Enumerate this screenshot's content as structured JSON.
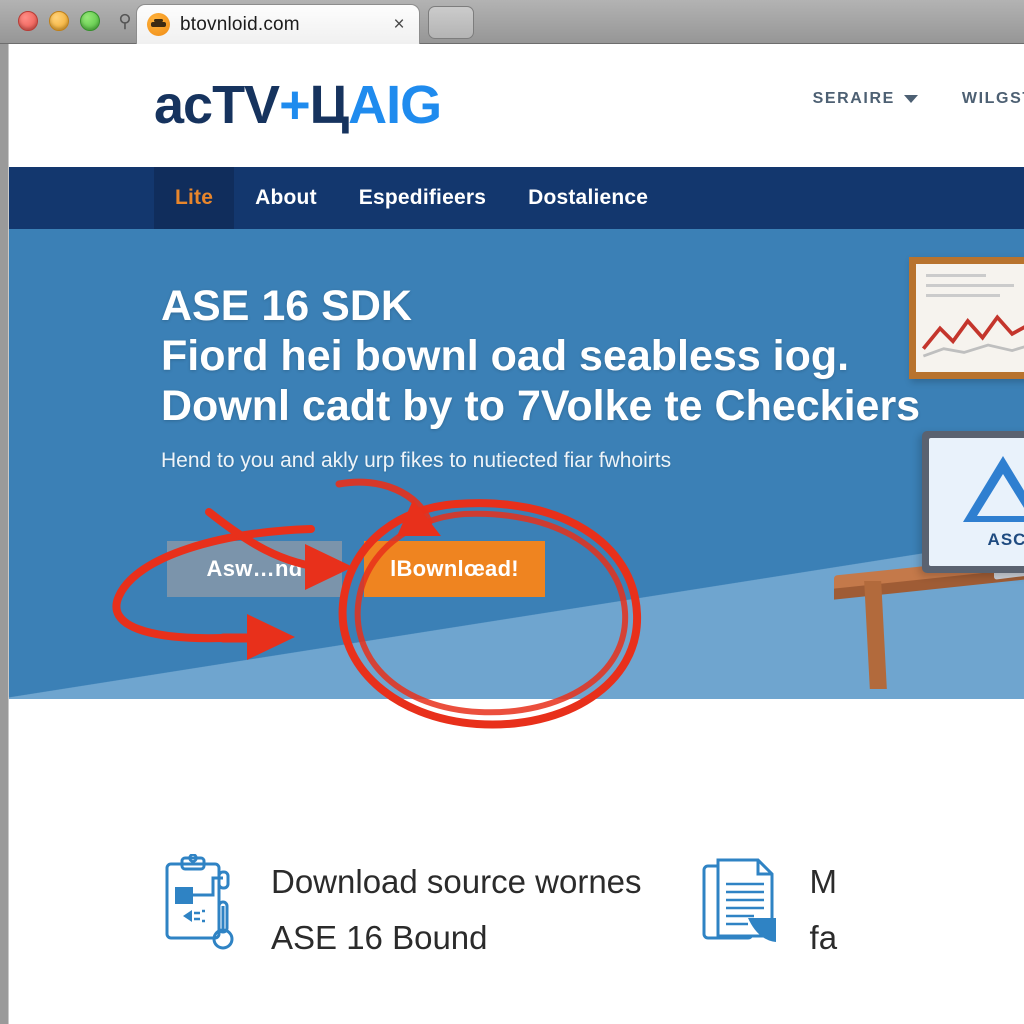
{
  "browser": {
    "window_controls": [
      "close",
      "minimize",
      "maximize"
    ],
    "tab": {
      "favicon": "orange-circle-favicon",
      "title": "btovnloid.com",
      "close_label": "×"
    },
    "new_tab_label": ""
  },
  "site": {
    "logo": {
      "part1": "acTV",
      "part2": "+",
      "part3": "Ц",
      "part4": "AIG"
    },
    "header_nav": [
      {
        "label": "SERAIRE",
        "has_caret": true
      },
      {
        "label": "WILGSTE",
        "has_caret": false
      }
    ],
    "main_nav": [
      {
        "label": "Lite",
        "active": true
      },
      {
        "label": "About",
        "active": false
      },
      {
        "label": "Espedifieers",
        "active": false
      },
      {
        "label": "Dostalience",
        "active": false
      }
    ],
    "hero": {
      "heading_line1": "ASE 16 SDK",
      "heading_line2": "Fiord hei bownl oad seabless iog.",
      "heading_line3": "Downl cadt by to 7Volke te Checkiers",
      "subtext": "Hend to you and akly urp fikes to nutiected fiar fwhoirts",
      "secondary_button": "Asw…nd",
      "primary_button": "lBownlœad!",
      "illustration": {
        "monitor_logo_label": "ASC"
      }
    },
    "features": [
      {
        "icon": "clipboard-device-icon",
        "line1": "Download source wornes",
        "line2": "ASE 16 Bound"
      },
      {
        "icon": "document-page-icon",
        "line1": "M",
        "line2": "fa"
      }
    ]
  },
  "annotations": {
    "circle_target": "primary-download-button",
    "arrow_left_target": "secondary-button",
    "arrow_top_target": "primary-download-button",
    "color": "#e8301b"
  },
  "colors": {
    "nav_navy": "#13376e",
    "hero_blue": "#3b80b6",
    "accent_orange": "#ef8420",
    "logo_blue": "#1f8bee",
    "logo_navy": "#16335e",
    "annotation_red": "#e8301b"
  }
}
